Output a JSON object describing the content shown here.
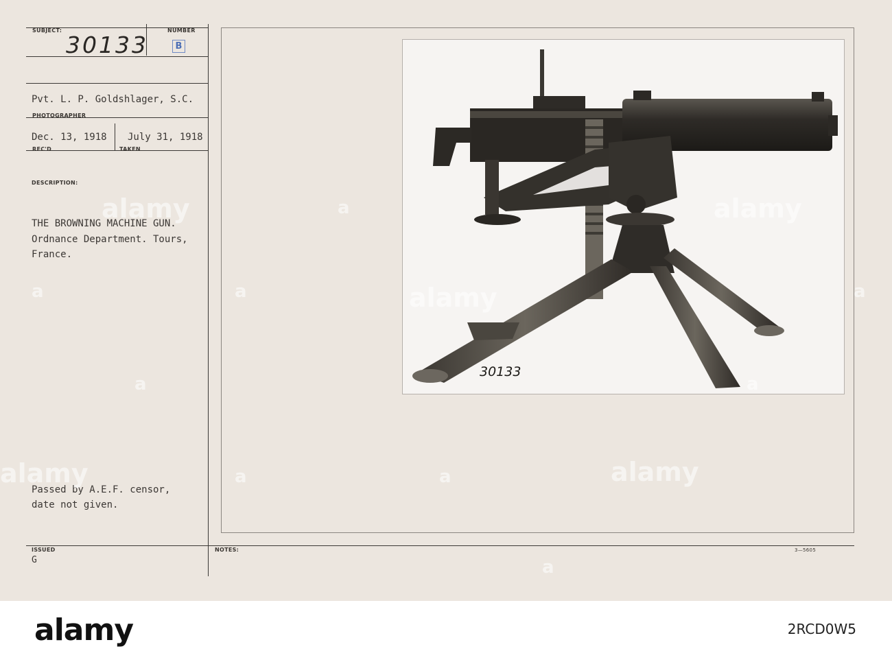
{
  "card": {
    "subject_label": "SUBJECT:",
    "subject_value": "30133",
    "number_label": "NUMBER",
    "number_stamp": "B",
    "photographer_value": "Pvt. L. P. Goldshlager, S.C.",
    "photographer_label": "PHOTOGRAPHER",
    "recd_value": "Dec. 13, 1918",
    "recd_label": "REC'D",
    "taken_value": "July 31, 1918",
    "taken_label": "TAKEN",
    "description_label": "DESCRIPTION:",
    "description_lines": [
      "THE BROWNING MACHINE GUN.",
      "Ordnance Department. Tours,",
      "France."
    ],
    "censor_lines": [
      "Passed by A.E.F. censor,",
      "date not given."
    ],
    "issued_label": "ISSUED",
    "issued_value": "G",
    "notes_label": "NOTES:",
    "form_code": "3—5605"
  },
  "photo": {
    "negative_number": "30133"
  },
  "watermark": {
    "text": "alamy",
    "fragment": "a"
  },
  "footer": {
    "logo": "alamy",
    "image_id": "2RCD0W5"
  }
}
